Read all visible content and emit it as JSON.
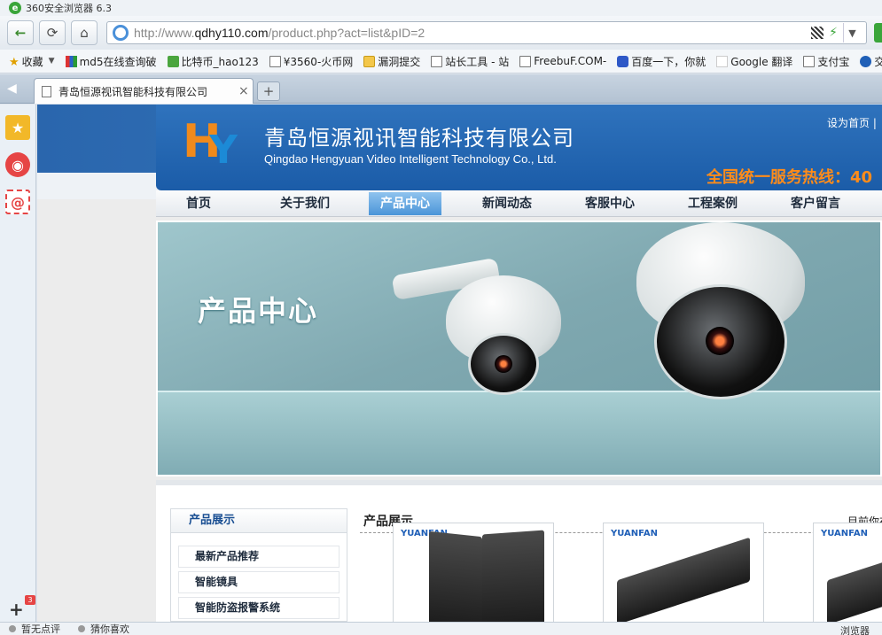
{
  "window": {
    "title": "360安全浏览器 6.3",
    "logo": "e"
  },
  "nav": {
    "back_icon": "back-arrow-icon",
    "refresh_icon": "refresh-icon",
    "home_icon": "home-icon"
  },
  "address": {
    "scheme_host_prefix": "http://www.",
    "host": "qdhy110.com",
    "path": "/product.php?act=list&pID=2"
  },
  "bookmarks": [
    {
      "label": "收藏",
      "icon": "star"
    },
    {
      "label": "md5在线查询破",
      "icon": "mul"
    },
    {
      "label": "比特币_hao123",
      "icon": "green"
    },
    {
      "label": "¥3560-火币网",
      "icon": "file"
    },
    {
      "label": "漏洞提交",
      "icon": "folder"
    },
    {
      "label": "站长工具 - 站",
      "icon": "file"
    },
    {
      "label": "FreebuF.COM-",
      "icon": "file"
    },
    {
      "label": "百度一下，你就",
      "icon": "paw"
    },
    {
      "label": "Google 翻译",
      "icon": "g"
    },
    {
      "label": "支付宝",
      "icon": "file"
    },
    {
      "label": "交通",
      "icon": "blue"
    }
  ],
  "tab": {
    "title": "青岛恒源视讯智能科技有限公司",
    "close": "×",
    "new": "+"
  },
  "sidebar": {
    "add": "+",
    "badge": "3"
  },
  "site": {
    "logo_h": "H",
    "logo_y": "Y",
    "company_cn": "青岛恒源视讯智能科技有限公司",
    "company_en": "Qingdao Hengyuan Video Intelligent Technology Co., Ltd.",
    "set_home": "设为首页 |",
    "hotline": "全国统一服务热线：40",
    "menu": [
      "首页",
      "关于我们",
      "产品中心",
      "新闻动态",
      "客服中心",
      "工程案例",
      "客户留言"
    ],
    "menu_active": 2,
    "banner_title": "产品中心",
    "sidebar_title": "产品展示",
    "categories": [
      "最新产品推荐",
      "智能镜具",
      "智能防盗报警系统"
    ],
    "content_title": "产品展示",
    "breadcrumb": "目前你在",
    "thumb_brand": "YUANFAN"
  },
  "status": {
    "left1": "暂无点评",
    "left2": "猜你喜欢",
    "right": "浏览器"
  }
}
